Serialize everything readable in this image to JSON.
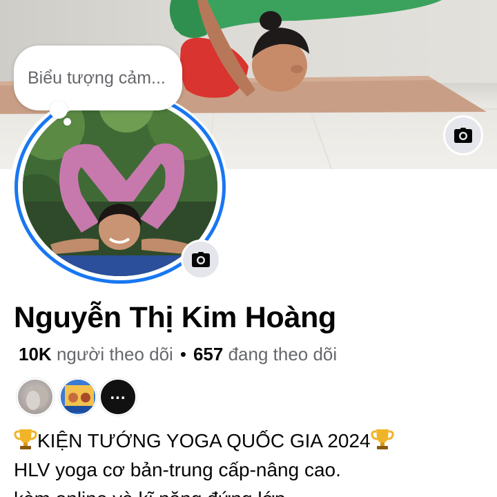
{
  "note": {
    "placeholder": "Biểu tượng cảm..."
  },
  "profile": {
    "name": "Nguyễn Thị Kim Hoàng",
    "followers_count": "10K",
    "followers_label": "người theo dõi",
    "separator": "•",
    "following_count": "657",
    "following_label": "đang theo dõi"
  },
  "mutual_friends": [
    {
      "label": "mutual-friend-1"
    },
    {
      "label": "mutual-friend-2"
    },
    {
      "label": "more",
      "text": "..."
    }
  ],
  "bio": {
    "line1": "KIỆN TƯỚNG YOGA QUỐC GIA 2024",
    "line2": "HLV yoga cơ bản-trung cấp-nâng cao.",
    "line3": "kèm online và kĩ năng đứng lớp"
  },
  "icons": {
    "cover_camera": "camera-icon",
    "avatar_camera": "camera-icon",
    "trophy": "trophy-icon"
  },
  "colors": {
    "story_ring": "#1877f2",
    "icon_button_bg": "#e4e6eb",
    "secondary_text": "#65676b",
    "primary_text": "#050505"
  }
}
